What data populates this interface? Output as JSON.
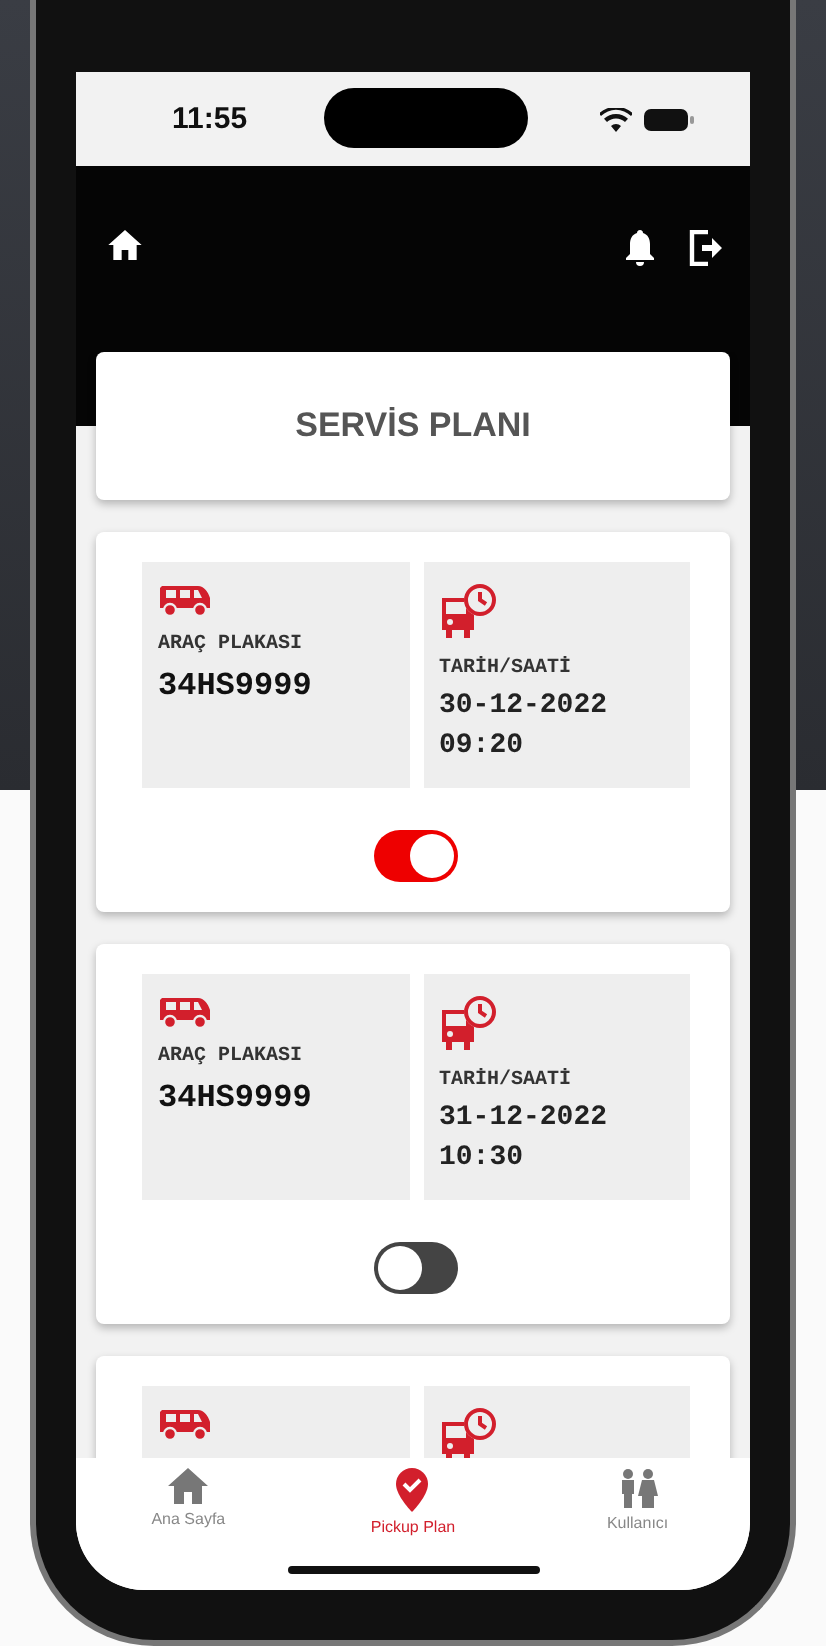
{
  "status_bar": {
    "time": "11:55"
  },
  "title": "SERVİS PLANI",
  "plans": [
    {
      "kind": "full",
      "plate_label": "ARAÇ PLAKASI",
      "plate": "34HS9999",
      "date_label": "TARİH/SAATİ",
      "date": "30-12-2022",
      "time": "09:20",
      "on": true
    },
    {
      "kind": "full",
      "plate_label": "ARAÇ PLAKASI",
      "plate": "34HS9999",
      "date_label": "TARİH/SAATİ",
      "date": "31-12-2022",
      "time": "10:30",
      "on": false
    },
    {
      "kind": "peek"
    }
  ],
  "tabs": [
    {
      "label": "Ana Sayfa",
      "kind": "home",
      "selected": false
    },
    {
      "label": "Pickup Plan",
      "kind": "pickup",
      "selected": true
    },
    {
      "label": "Kullanıcı",
      "kind": "user",
      "selected": false
    }
  ]
}
